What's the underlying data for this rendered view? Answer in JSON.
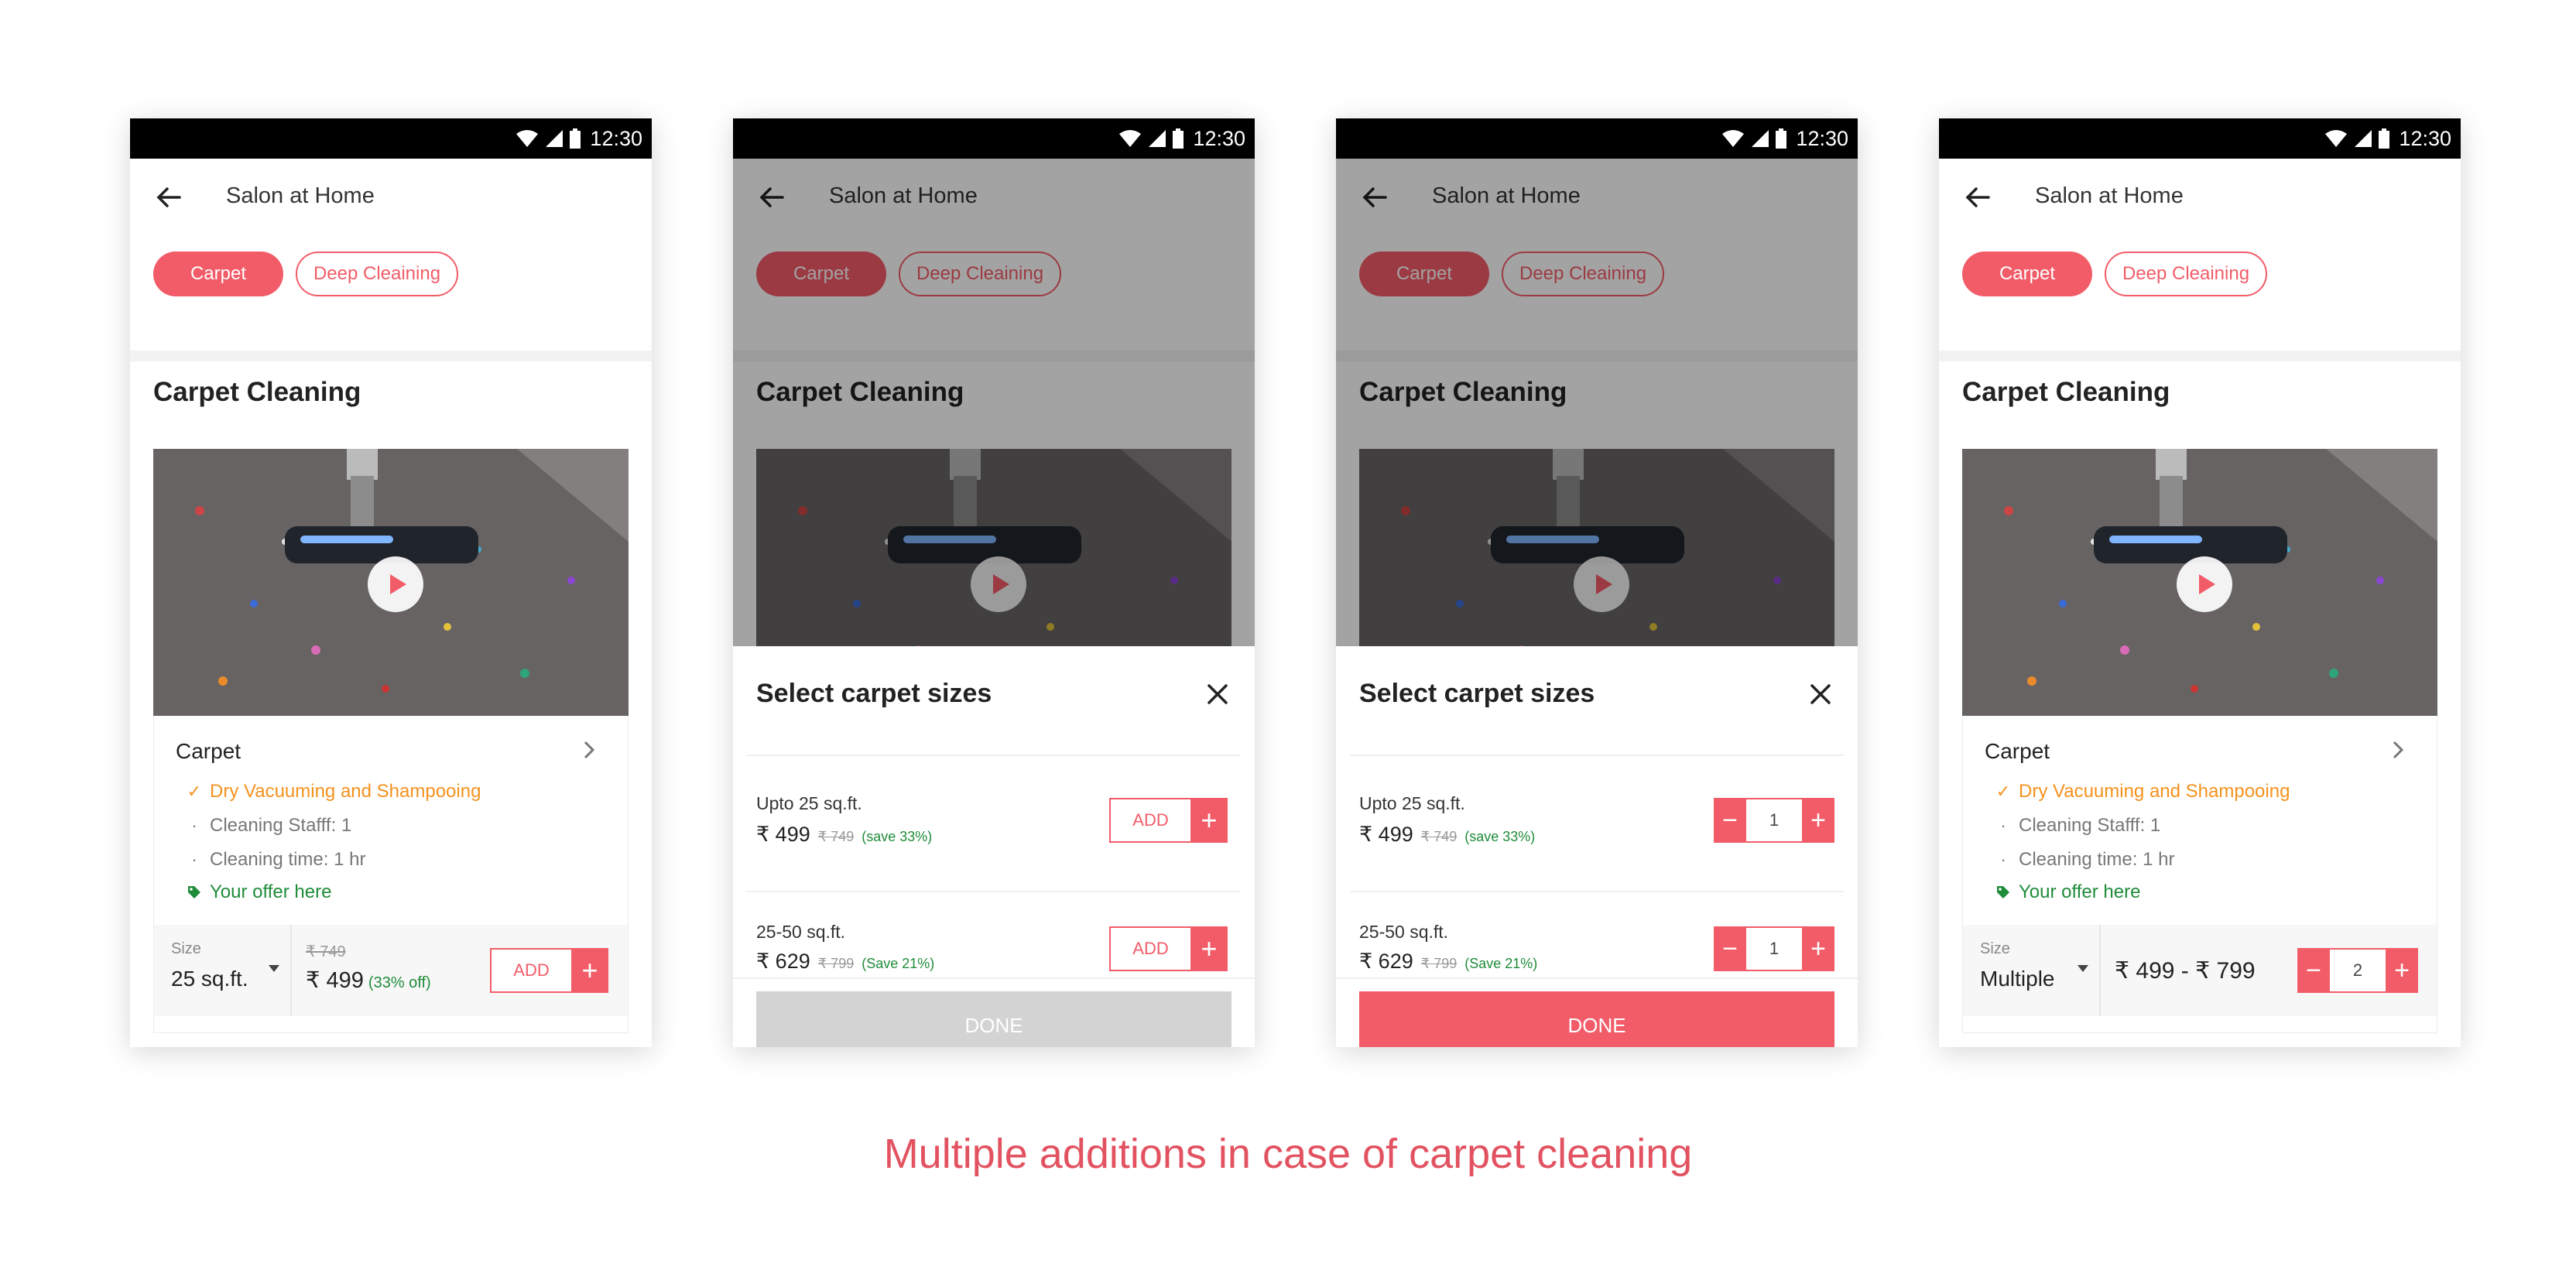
{
  "status_bar": {
    "time": "12:30"
  },
  "header": {
    "title": "Salon at Home"
  },
  "chips": [
    "Carpet",
    "Deep Cleaining"
  ],
  "section_title": "Carpet Cleaning",
  "service": {
    "name": "Carpet",
    "features": [
      {
        "text": "Dry Vacuuming and Shampooing",
        "icon": "check-icon",
        "color": "#f5921e"
      },
      {
        "text": "Cleaning Stafff: 1",
        "icon": "bullet-icon",
        "color": "#777777"
      },
      {
        "text": "Cleaning time: 1 hr",
        "icon": "bullet-icon",
        "color": "#777777"
      },
      {
        "text": "Your offer here",
        "icon": "tag-icon",
        "color": "#1f8c3a"
      }
    ]
  },
  "screen1": {
    "size_label": "Size",
    "size_value": "25 sq.ft.",
    "old_price": "₹ 749",
    "price": "₹ 499",
    "discount": "(33% off)",
    "add_label": "ADD",
    "plus": "+"
  },
  "sheet": {
    "title": "Select carpet sizes",
    "options": [
      {
        "label": "Upto 25 sq.ft.",
        "price": "₹ 499",
        "old_price": "₹ 749",
        "save": "(save 33%)"
      },
      {
        "label": "25-50 sq.ft.",
        "price": "₹ 629",
        "old_price": "₹ 799",
        "save": "(Save 21%)"
      }
    ],
    "add_label": "ADD",
    "plus": "+",
    "minus": "−",
    "qty": "1",
    "done_label": "DONE"
  },
  "screen4": {
    "size_label": "Size",
    "size_value": "Multiple",
    "price_range": "₹ 499 - ₹ 799",
    "qty": "2",
    "minus": "−",
    "plus": "+"
  },
  "caption": "Multiple additions in case of carpet cleaning",
  "colors": {
    "accent": "#f25c68",
    "offer": "#1f8c3a",
    "highlight": "#f5921e",
    "caption": "#e25260"
  }
}
